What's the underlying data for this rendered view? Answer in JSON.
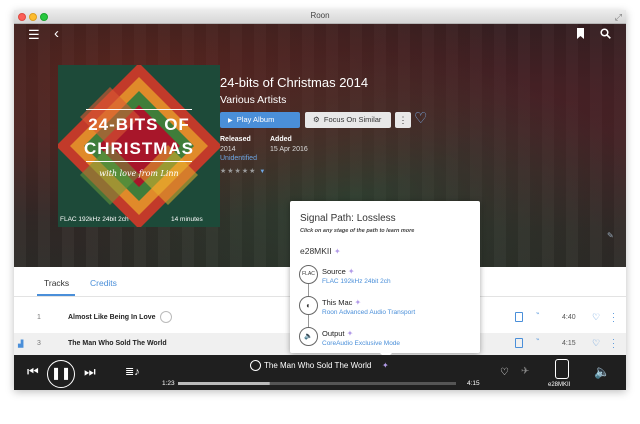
{
  "window": {
    "title": "Roon"
  },
  "album": {
    "title": "24-bits of Christmas 2014",
    "artist": "Various Artists",
    "cover_title_line1": "24-BITS OF",
    "cover_title_line2": "CHRISTMAS",
    "cover_subtitle": "with love from Linn",
    "format": "FLAC 192kHz 24bit 2ch",
    "duration": "14 minutes",
    "released_label": "Released",
    "released_value": "2014",
    "identification": "Unidentified",
    "added_label": "Added",
    "added_value": "15 Apr 2016",
    "rating_stars": "★★★★★",
    "rating_value": 0,
    "buttons": {
      "play": "Play Album",
      "focus": "Focus On Similar",
      "more": "⋮"
    }
  },
  "tabs": [
    {
      "label": "Tracks",
      "active": true
    },
    {
      "label": "Credits",
      "active": false
    }
  ],
  "tracks": [
    {
      "num": "1",
      "title": "Almost Like Being In Love",
      "time": "4:40",
      "playing": false
    },
    {
      "num": "3",
      "title": "The Man Who Sold The World",
      "time": "4:15",
      "playing": true
    }
  ],
  "signal_path": {
    "title_prefix": "Signal Path:",
    "quality": "Lossless",
    "hint": "Click on any stage of the path to learn more",
    "zone": "e28MKII",
    "stages": [
      {
        "label": "Source",
        "value": "FLAC 192kHz 24bit 2ch",
        "icon": "flac-icon",
        "icon_text": "FLAC"
      },
      {
        "label": "This Mac",
        "value": "Roon Advanced Audio Transport",
        "icon": "speaker-half-icon",
        "icon_text": "◐"
      },
      {
        "label": "Output",
        "value": "CoreAudio Exclusive Mode",
        "icon": "speaker-icon",
        "icon_text": "🔈"
      }
    ]
  },
  "player": {
    "now_playing": "The Man Who Sold The World",
    "position": "1:23",
    "total": "4:15",
    "progress": 0.33,
    "zone": "e28MKII"
  },
  "colors": {
    "accent": "#4a8fd9",
    "quality_star": "#b39ce8",
    "play_button": "#4a8fd9"
  },
  "icons": {
    "menu": "menu-icon",
    "back": "back-arrow-icon",
    "bookmark": "bookmark-icon",
    "search": "search-icon"
  }
}
